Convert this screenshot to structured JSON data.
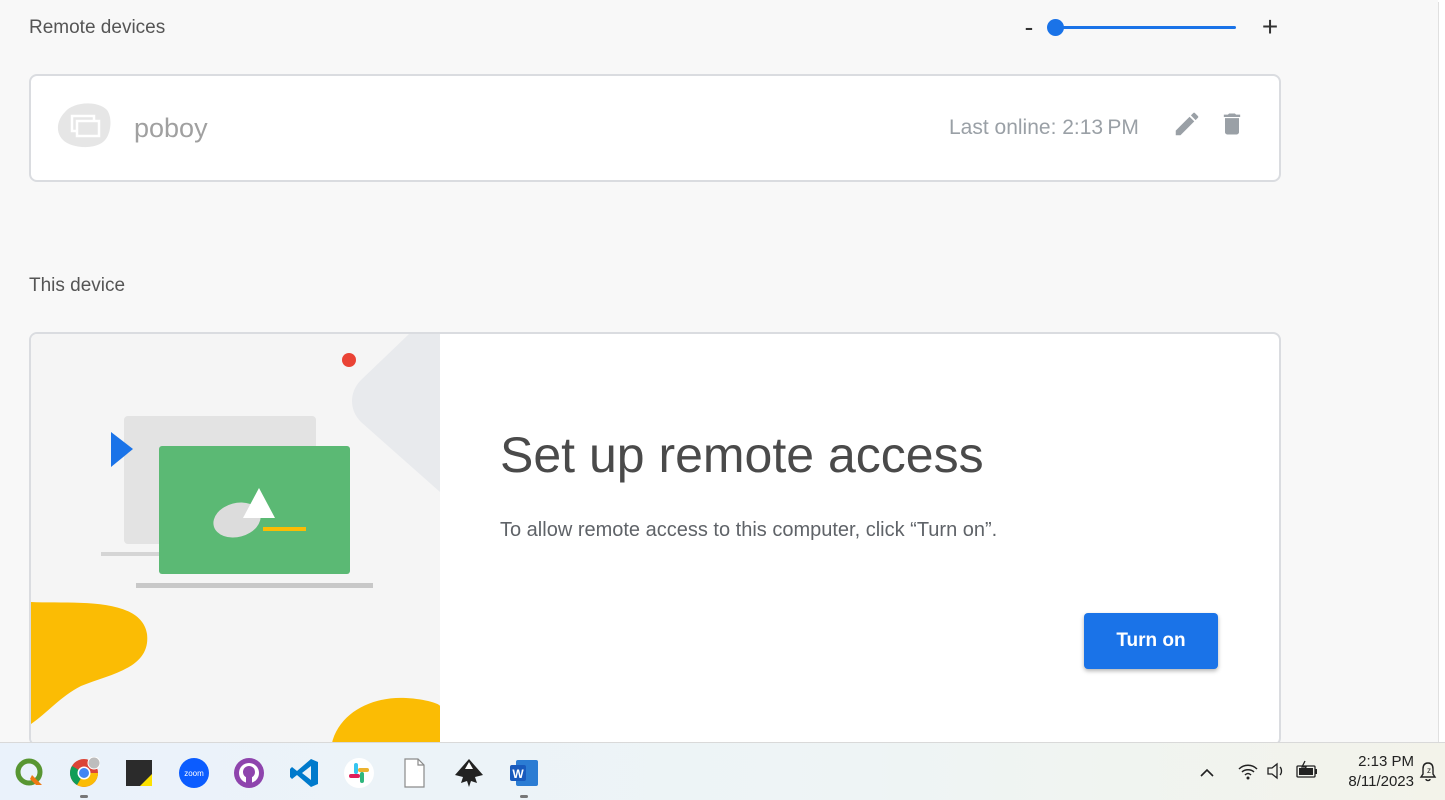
{
  "remote": {
    "title": "Remote devices",
    "zoom_minus": "-",
    "zoom_plus": "+",
    "zoom_level": 0.0,
    "device": {
      "name": "poboy",
      "last_online": "Last online: 2:13 PM",
      "icon": "computer-icon",
      "edit_icon": "pencil-icon",
      "delete_icon": "trash-icon"
    }
  },
  "this_device": {
    "title": "This device",
    "heading": "Set up remote access",
    "description": "To allow remote access to this computer, click “Turn on”.",
    "button": "Turn on"
  },
  "colors": {
    "accent": "#1a73e8",
    "illustration_green": "#5bb974",
    "illustration_yellow": "#fbbc04",
    "illustration_red": "#ea4335"
  },
  "taskbar": {
    "apps": [
      "qgis-icon",
      "chrome-icon",
      "sticky-notes-icon",
      "zoom-icon",
      "github-desktop-icon",
      "vscode-icon",
      "slack-icon",
      "file-icon",
      "inkscape-icon",
      "word-icon"
    ],
    "zoom_app_label": "zoom",
    "word_app_label": "W",
    "time": "2:13 PM",
    "date": "8/11/2023"
  }
}
